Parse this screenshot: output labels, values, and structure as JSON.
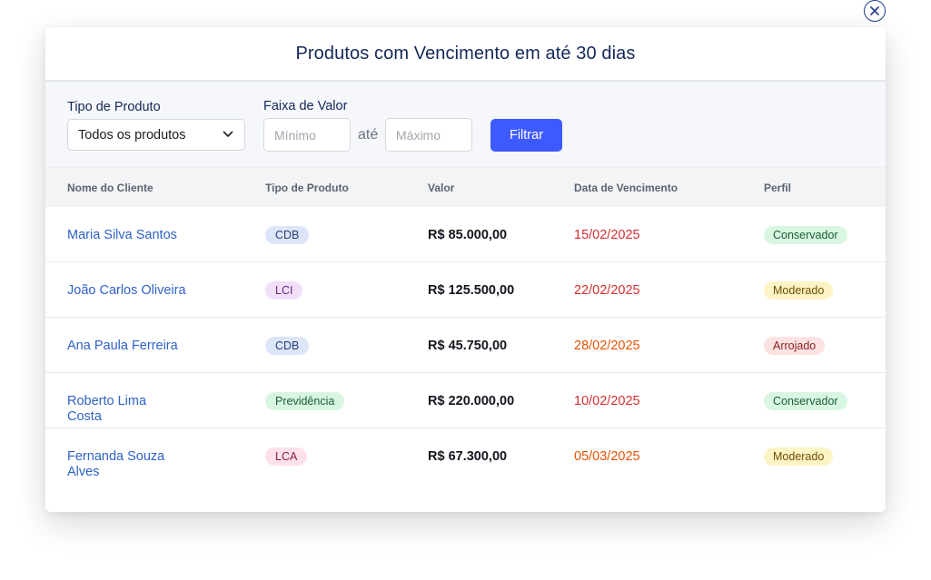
{
  "modal": {
    "title": "Produtos com Vencimento em até 30 dias"
  },
  "filters": {
    "product_type_label": "Tipo de Produto",
    "product_type_value": "Todos os produtos",
    "value_range_label": "Faixa de Valor",
    "min_placeholder": "Mínimo",
    "between_label": "até",
    "max_placeholder": "Máximo",
    "filter_button": "Filtrar"
  },
  "table": {
    "headers": [
      "Nome do Cliente",
      "Tipo de Produto",
      "Valor",
      "Data de Vencimento",
      "Perfil"
    ],
    "rows": [
      {
        "client": "Maria Silva Santos",
        "product": "CDB",
        "value": "R$ 85.000,00",
        "date": "15/02/2025",
        "profile": "Conservador"
      },
      {
        "client": "João Carlos Oliveira",
        "product": "LCI",
        "value": "R$ 125.500,00",
        "date": "22/02/2025",
        "profile": "Moderado"
      },
      {
        "client": "Ana Paula Ferreira",
        "product": "CDB",
        "value": "R$ 45.750,00",
        "date": "28/02/2025",
        "profile": "Arrojado"
      },
      {
        "client": "Roberto Lima Costa",
        "product": "Previdência",
        "value": "R$ 220.000,00",
        "date": "10/02/2025",
        "profile": "Conservador"
      },
      {
        "client": "Fernanda Souza Alves",
        "product": "LCA",
        "value": "R$ 67.300,00",
        "date": "05/03/2025",
        "profile": "Moderado"
      }
    ]
  },
  "colors": {
    "accent": "#3d5afe",
    "link": "#2f62c8",
    "date_urgent": "#d32f2f",
    "date_soon": "#e65100",
    "badge_cdb": "#dde6f8",
    "badge_lci": "#f1e0f8",
    "badge_previdencia": "#d8f5e2",
    "badge_lca": "#fce0ea",
    "profile_conservador": "#d9f6e3",
    "profile_moderado": "#fdf3c4",
    "profile_arrojado": "#fde2e2"
  },
  "icons": {
    "close": "close-icon",
    "dropdown": "chevron-down-icon"
  }
}
